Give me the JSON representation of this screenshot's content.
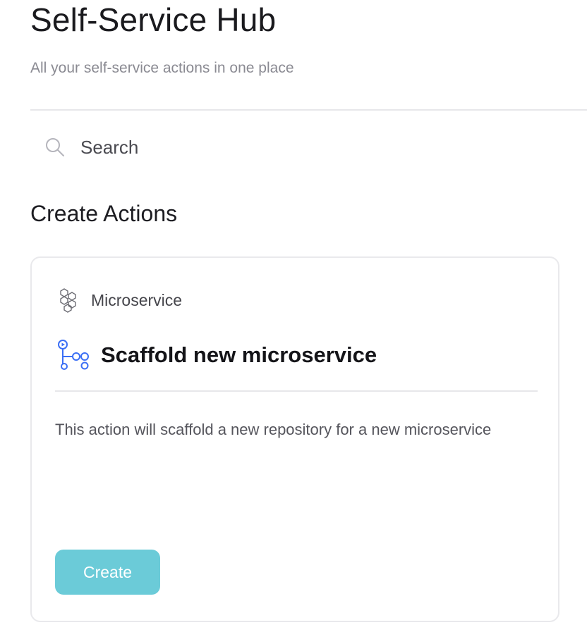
{
  "header": {
    "title": "Self-Service Hub",
    "subtitle": "All your self-service actions in one place"
  },
  "search": {
    "placeholder": "Search",
    "value": "",
    "icon": "search-icon"
  },
  "section": {
    "title": "Create Actions"
  },
  "action_card": {
    "category": "Microservice",
    "category_icon": "microservice-icon",
    "title": "Scaffold new microservice",
    "title_icon": "github-actions-icon",
    "description": "This action will scaffold a new repository for a new microservice",
    "button_label": "Create"
  },
  "colors": {
    "accent": "#6bcbd8",
    "icon_blue": "#3b6ff5",
    "muted_text": "#8a8a92"
  }
}
